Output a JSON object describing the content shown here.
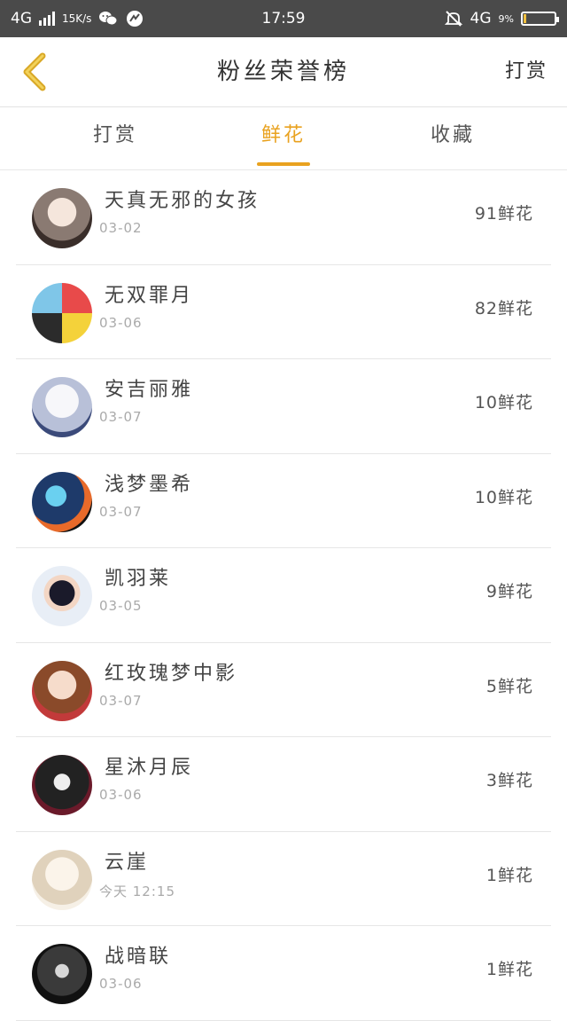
{
  "status_bar": {
    "network_left": "4G",
    "speed": "15K/s",
    "time": "17:59",
    "network_right": "4G",
    "battery_text": "9%",
    "battery_level": 0.09,
    "icons": [
      "signal-icon",
      "wechat-icon",
      "app-icon",
      "mute-icon",
      "battery-icon"
    ]
  },
  "header": {
    "back_icon": "chevron-left-icon",
    "title": "粉丝荣誉榜",
    "right_action": "打赏"
  },
  "tabs": [
    {
      "label": "打赏",
      "active": false
    },
    {
      "label": "鲜花",
      "active": true
    },
    {
      "label": "收藏",
      "active": false
    }
  ],
  "fans": [
    {
      "name": "天真无邪的女孩",
      "date": "03-02",
      "count": "91鲜花"
    },
    {
      "name": "无双罪月",
      "date": "03-06",
      "count": "82鲜花"
    },
    {
      "name": "安吉丽雅",
      "date": "03-07",
      "count": "10鲜花"
    },
    {
      "name": "浅梦墨希",
      "date": "03-07",
      "count": "10鲜花"
    },
    {
      "name": "凯羽莱",
      "date": "03-05",
      "count": "9鲜花"
    },
    {
      "name": "红玫瑰梦中影",
      "date": "03-07",
      "count": "5鲜花"
    },
    {
      "name": "星沐月辰",
      "date": "03-06",
      "count": "3鲜花"
    },
    {
      "name": "云崖",
      "date": "今天 12:15",
      "count": "1鲜花"
    },
    {
      "name": "战暗联",
      "date": "03-06",
      "count": "1鲜花"
    }
  ],
  "colors": {
    "accent": "#e9a21f",
    "status_bar_bg": "#4a4a4a",
    "back_icon": "#d9a826"
  }
}
